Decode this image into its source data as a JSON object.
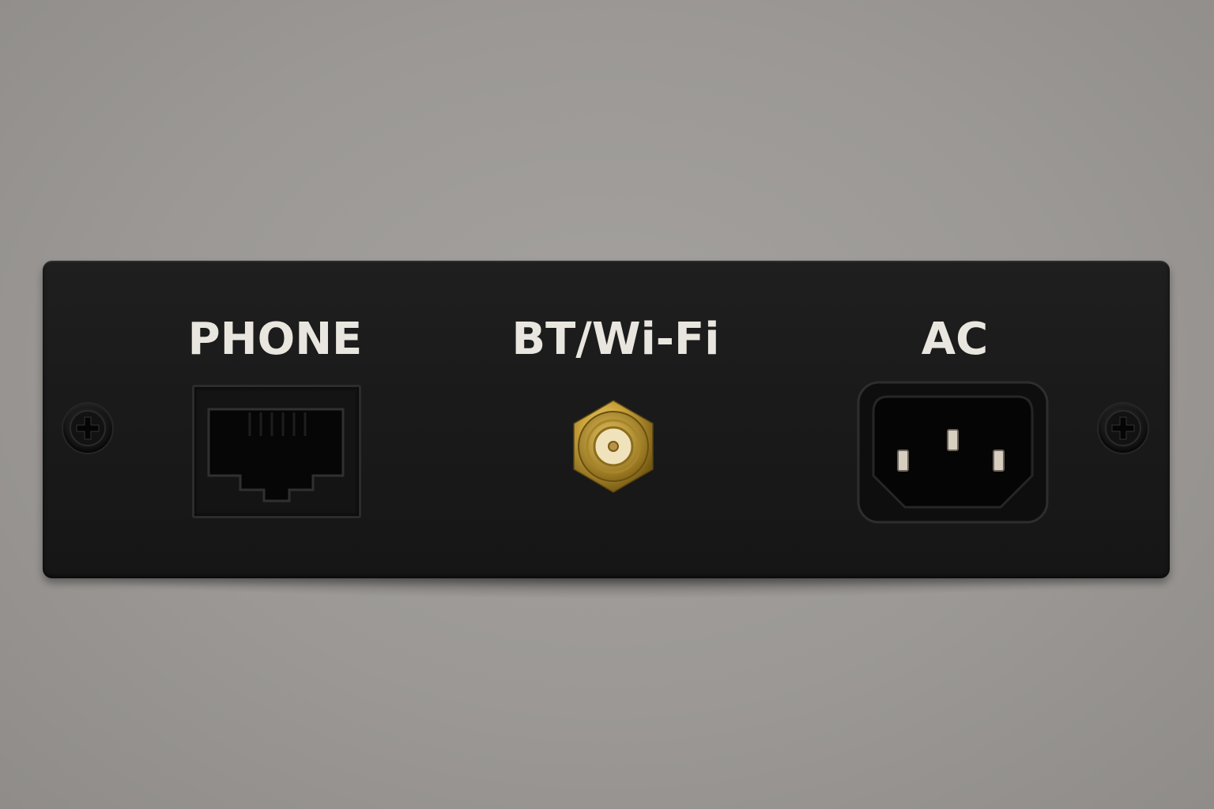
{
  "panel": {
    "labels": {
      "phone": "PHONE",
      "bt_wifi": "BT/Wi-Fi",
      "ac": "AC"
    }
  },
  "icons": {
    "left_screw": "phillips-screw-icon",
    "right_screw": "phillips-screw-icon",
    "phone_jack": "rj11-jack-icon",
    "antenna_connector": "sma-connector-icon",
    "power_inlet": "iec-c14-inlet-icon"
  },
  "colors": {
    "background": "#9b9895",
    "panel": "#1a1a1a",
    "label_text": "#e9e6df",
    "gold": "#c9a23a"
  }
}
